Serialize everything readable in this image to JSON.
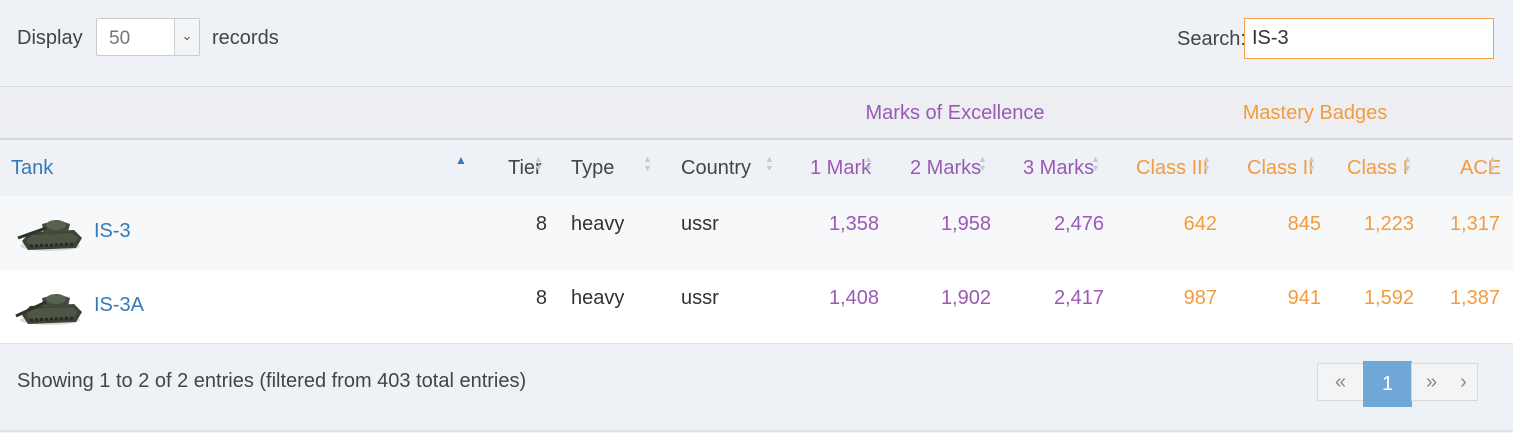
{
  "controls": {
    "display_label": "Display",
    "records_label": "records",
    "page_length": "50",
    "search_label": "Search:",
    "search_value": "IS-3"
  },
  "groups": {
    "marks": "Marks of Excellence",
    "mastery": "Mastery Badges"
  },
  "columns": {
    "tank": "Tank",
    "tier": "Tier",
    "type": "Type",
    "country": "Country",
    "mark1": "1 Mark",
    "mark2": "2 Marks",
    "mark3": "3 Marks",
    "class3": "Class III",
    "class2": "Class II",
    "class1": "Class I",
    "ace": "ACE"
  },
  "rows": [
    {
      "tank": "IS-3",
      "tier": "8",
      "type": "heavy",
      "country": "ussr",
      "mark1": "1,358",
      "mark2": "1,958",
      "mark3": "2,476",
      "class3": "642",
      "class2": "845",
      "class1": "1,223",
      "ace": "1,317"
    },
    {
      "tank": "IS-3A",
      "tier": "8",
      "type": "heavy",
      "country": "ussr",
      "mark1": "1,408",
      "mark2": "1,902",
      "mark3": "2,417",
      "class3": "987",
      "class2": "941",
      "class1": "1,592",
      "ace": "1,387"
    }
  ],
  "footer": {
    "info": "Showing 1 to 2 of 2 entries (filtered from 403 total entries)",
    "pager": {
      "first": "«",
      "current": "1",
      "next": "»",
      "last": "›"
    }
  },
  "colors": {
    "marks": "#9b59b6",
    "mastery": "#f39c3c",
    "link": "#337ab7",
    "active_page": "#6fa8d6"
  },
  "icons": {
    "sort_asc": "triangle-up-icon",
    "sort_both": "sort-icon",
    "select_caret": "chevron-down-icon"
  }
}
